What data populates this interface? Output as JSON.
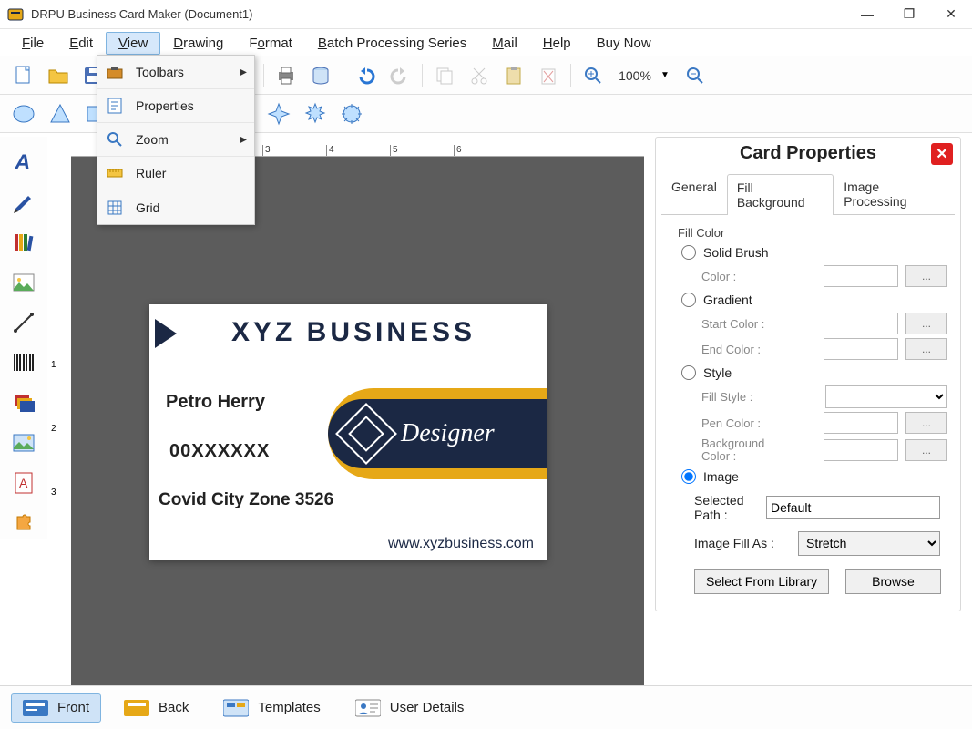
{
  "title": "DRPU Business Card Maker (Document1)",
  "menubar": [
    "File",
    "Edit",
    "View",
    "Drawing",
    "Format",
    "Batch Processing Series",
    "Mail",
    "Help",
    "Buy Now"
  ],
  "menubar_hotkeys": [
    "F",
    "E",
    "V",
    "D",
    "o",
    "B",
    "M",
    "H",
    ""
  ],
  "dropdown": {
    "toolbars": "Toolbars",
    "properties": "Properties",
    "zoom": "Zoom",
    "ruler": "Ruler",
    "grid": "Grid"
  },
  "toolbar1_icons": [
    "new-icon",
    "open-icon",
    "save-icon",
    "undo-list-icon",
    "paste-list-icon",
    "color-select-icon",
    "align-icon",
    "print-icon",
    "database-icon",
    "undo-icon",
    "redo-icon",
    "copy-icon",
    "cut-icon",
    "paste-icon",
    "delete-icon",
    "zoom-in-icon",
    "zoom-out-icon"
  ],
  "zoom_value": "100%",
  "toolbar2_icons": [
    "ellipse-icon",
    "triangle-icon",
    "rect-icon",
    "rounded-rect-icon",
    "diamond-icon",
    "hexagon-icon",
    "arrow-icon",
    "star4-icon",
    "star8-icon",
    "burst-icon"
  ],
  "left_icons": [
    "text-tool-icon",
    "pen-tool-icon",
    "library-icon",
    "image-icon",
    "line-icon",
    "barcode-icon",
    "stack-icon",
    "gallery-icon",
    "font-page-icon",
    "puzzle-icon"
  ],
  "card": {
    "title": "XYZ BUSINESS",
    "name": "Petro Herry",
    "phone": "00XXXXXX",
    "addr": "Covid City Zone 3526",
    "web": "www.xyzbusiness.com",
    "designer": "Designer"
  },
  "props": {
    "header": "Card Properties",
    "tabs": {
      "general": "General",
      "fill": "Fill Background",
      "img": "Image Processing"
    },
    "fill_color_label": "Fill Color",
    "solid": "Solid Brush",
    "color": "Color :",
    "gradient": "Gradient",
    "start": "Start Color :",
    "end": "End Color :",
    "style": "Style",
    "fillstyle": "Fill Style :",
    "pen": "Pen Color :",
    "bg": "Background Color :",
    "image": "Image",
    "selpath": "Selected Path :",
    "selpath_val": "Default",
    "fillas": "Image Fill As :",
    "fillas_val": "Stretch",
    "lib_btn": "Select From Library",
    "browse_btn": "Browse"
  },
  "bottom": {
    "front": "Front",
    "back": "Back",
    "templates": "Templates",
    "user": "User Details"
  },
  "ruler_marks": [
    "3",
    "4",
    "5",
    "6"
  ]
}
